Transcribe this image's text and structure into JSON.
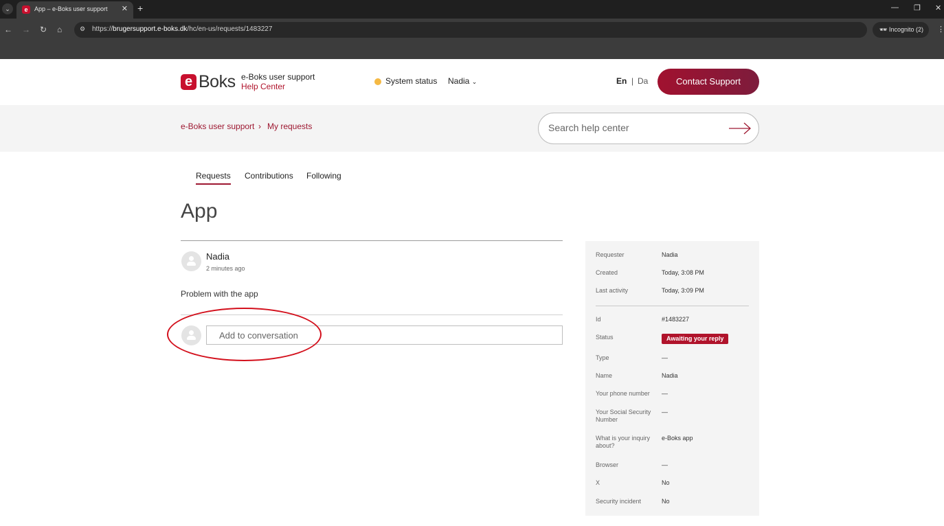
{
  "browser": {
    "tab_title": "App – e-Boks user support",
    "tab_favicon": "e",
    "new_tab": "+",
    "url_prefix": "https://",
    "url_domain": "brugersupport.e-boks.dk",
    "url_path": "/hc/en-us/requests/1483227",
    "incognito_label": "Incognito (2)"
  },
  "header": {
    "logo_e": "e",
    "logo_text": "Boks",
    "brand_title": "e-Boks user support",
    "brand_subtitle": "Help Center",
    "system_status": "System status",
    "user_name": "Nadia",
    "lang_en": "En",
    "lang_separator": "|",
    "lang_da": "Da",
    "contact_button": "Contact Support",
    "status_color": "#f5b944",
    "accent_color": "#9d1730"
  },
  "breadcrumb": {
    "items": [
      "e-Boks user support",
      "My requests"
    ],
    "separator": "›"
  },
  "search": {
    "placeholder": "Search help center"
  },
  "tabs": [
    "Requests",
    "Contributions",
    "Following"
  ],
  "request": {
    "title": "App",
    "author": "Nadia",
    "time_ago": "2 minutes ago",
    "message": "Problem with the app",
    "reply_placeholder": "Add to conversation"
  },
  "details": {
    "rows_top": [
      {
        "label": "Requester",
        "value": "Nadia"
      },
      {
        "label": "Created",
        "value": "Today, 3:08 PM"
      },
      {
        "label": "Last activity",
        "value": "Today, 3:09 PM"
      }
    ],
    "rows_bottom": [
      {
        "label": "Id",
        "value": "#1483227"
      },
      {
        "label": "Status",
        "value": "Awaiting your reply"
      },
      {
        "label": "Type",
        "value": "—"
      },
      {
        "label": "Name",
        "value": "Nadia"
      },
      {
        "label": "Your phone number",
        "value": "—"
      },
      {
        "label": "Your Social Security Number",
        "value": "—"
      },
      {
        "label": "What is your inquiry about?",
        "value": "e-Boks app"
      },
      {
        "label": "Browser",
        "value": "—"
      },
      {
        "label": "X",
        "value": "No"
      },
      {
        "label": "Security incident",
        "value": "No"
      }
    ]
  }
}
